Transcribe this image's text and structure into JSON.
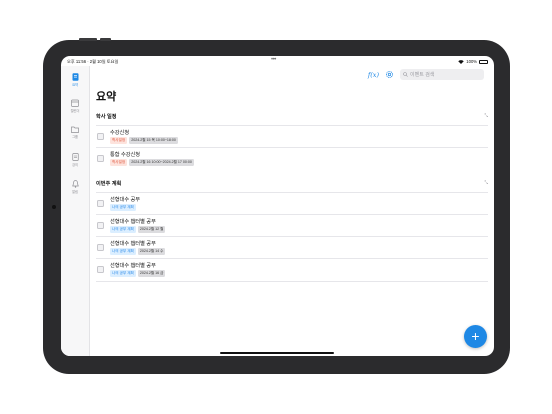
{
  "status_bar": {
    "time_date": "오후 11:56 · 2월 10일 토요일",
    "dots": "•••",
    "battery": "100%"
  },
  "sidebar": {
    "items": [
      {
        "label": "요약",
        "icon": "summary-icon",
        "active": true
      },
      {
        "label": "캘린더",
        "icon": "calendar-icon",
        "active": false
      },
      {
        "label": "그룹",
        "icon": "folder-icon",
        "active": false
      },
      {
        "label": "강의",
        "icon": "document-icon",
        "active": false
      },
      {
        "label": "알림",
        "icon": "bell-icon",
        "active": false
      }
    ]
  },
  "toolbar": {
    "fx_label": "f(x)",
    "search_placeholder": "이벤트 검색"
  },
  "page": {
    "title": "요약"
  },
  "sections": [
    {
      "title": "학사 일정",
      "rows": [
        {
          "title": "수강신청",
          "tags": [
            {
              "text": "학사일정",
              "style": "red"
            },
            {
              "text": "2024.2월 15 목 10:00~18:00",
              "style": "gray"
            }
          ]
        },
        {
          "title": "통합 수강신청",
          "tags": [
            {
              "text": "학사일정",
              "style": "red"
            },
            {
              "text": "2024.2월 16 10:00~2024.2월 17 00:00",
              "style": "gray"
            }
          ]
        }
      ]
    },
    {
      "title": "이번주 계획",
      "rows": [
        {
          "title": "선형대수 공부",
          "tags": [
            {
              "text": "나의 공부 계획",
              "style": "blue"
            }
          ]
        },
        {
          "title": "선형대수 챕터별 공부",
          "tags": [
            {
              "text": "나의 공부 계획",
              "style": "blue"
            },
            {
              "text": "2024.2월 12 월",
              "style": "gray"
            }
          ]
        },
        {
          "title": "선형대수 챕터별 공부",
          "tags": [
            {
              "text": "나의 공부 계획",
              "style": "blue"
            },
            {
              "text": "2024.2월 14 수",
              "style": "gray"
            }
          ]
        },
        {
          "title": "선형대수 챕터별 공부",
          "tags": [
            {
              "text": "나의 공부 계획",
              "style": "blue"
            },
            {
              "text": "2024.2월 16 금",
              "style": "gray"
            }
          ]
        }
      ]
    }
  ],
  "fab": {
    "label": "+"
  },
  "colors": {
    "accent": "#1e88e5",
    "tag_red_bg": "#fde3dd",
    "tag_blue_bg": "#dbeeff",
    "tag_gray_bg": "#dcdcdf"
  }
}
